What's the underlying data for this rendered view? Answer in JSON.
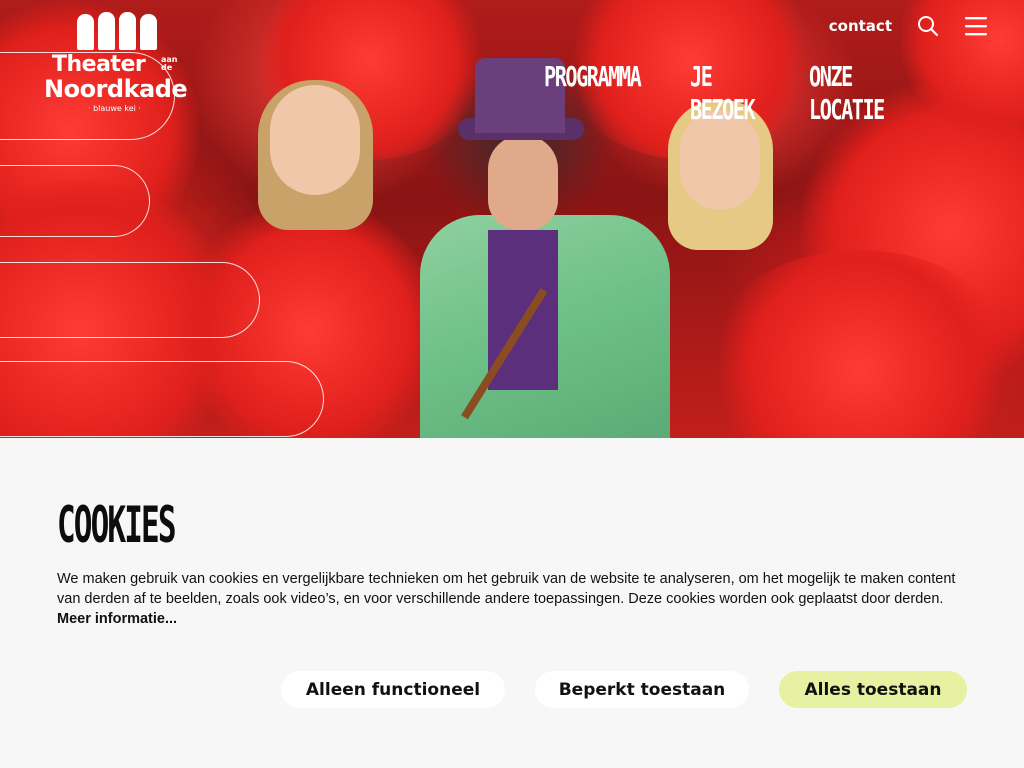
{
  "logo": {
    "line1": "Theater",
    "small": "aan de",
    "line2": "Noordkade",
    "tagline": "· blauwe kei ·"
  },
  "topnav": {
    "contact": "contact",
    "search_icon": "search-icon",
    "menu_icon": "hamburger-menu-icon"
  },
  "mainnav": {
    "items": [
      {
        "label": "PROGRAMMA"
      },
      {
        "label": "JE BEZOEK"
      },
      {
        "label": "ONZE LOCATIE"
      }
    ]
  },
  "cookie": {
    "title": "COOKIES",
    "text": "We maken gebruik van cookies en vergelijkbare technieken om het gebruik van de website te analyseren, om het mogelijk te maken content van derden af te beelden, zoals ook video’s, en voor verschillende andere toepassingen. Deze cookies worden ook geplaatst door derden.",
    "more_link": "Meer informatie...",
    "buttons": {
      "functional": "Alleen functioneel",
      "limited": "Beperkt toestaan",
      "all": "Alles toestaan"
    }
  },
  "colors": {
    "accent_button": "#e6f2a2",
    "panel_bg": "#f7f7f7",
    "text": "#111111"
  }
}
